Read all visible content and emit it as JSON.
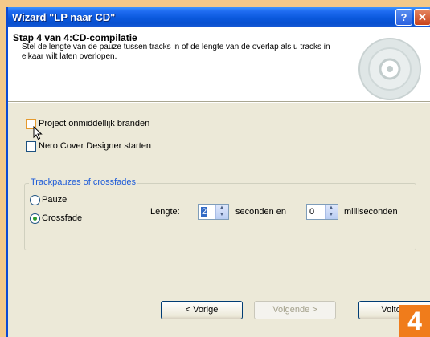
{
  "window": {
    "title": "Wizard \"LP naar CD\"",
    "help_icon": "?",
    "close_icon": "✕"
  },
  "header": {
    "title": "Stap 4 van 4:CD-compilatie",
    "description": "Stel de lengte van de pauze tussen tracks in of de lengte van de overlap als u tracks in elkaar wilt laten overlopen."
  },
  "options": {
    "burn_label": "Project onmiddellijk branden",
    "burn_checked": false,
    "cover_label": "Nero Cover Designer starten",
    "cover_checked": false
  },
  "group": {
    "legend": "Trackpauzes of crossfades",
    "pause_label": "Pauze",
    "crossfade_label": "Crossfade",
    "selected": "Crossfade",
    "length_label": "Lengte:",
    "seconds_value": "2",
    "seconds_label": "seconden en",
    "ms_value": "0",
    "ms_label": "milliseconden"
  },
  "buttons": {
    "back": "< Vorige",
    "next": "Volgende >",
    "finish": "Voltooien"
  },
  "badge": "4",
  "colors": {
    "titlebar": "#0a58dc",
    "legend": "#1c5ad8",
    "badge": "#f07c1b",
    "page_bg": "#f3c98a"
  }
}
